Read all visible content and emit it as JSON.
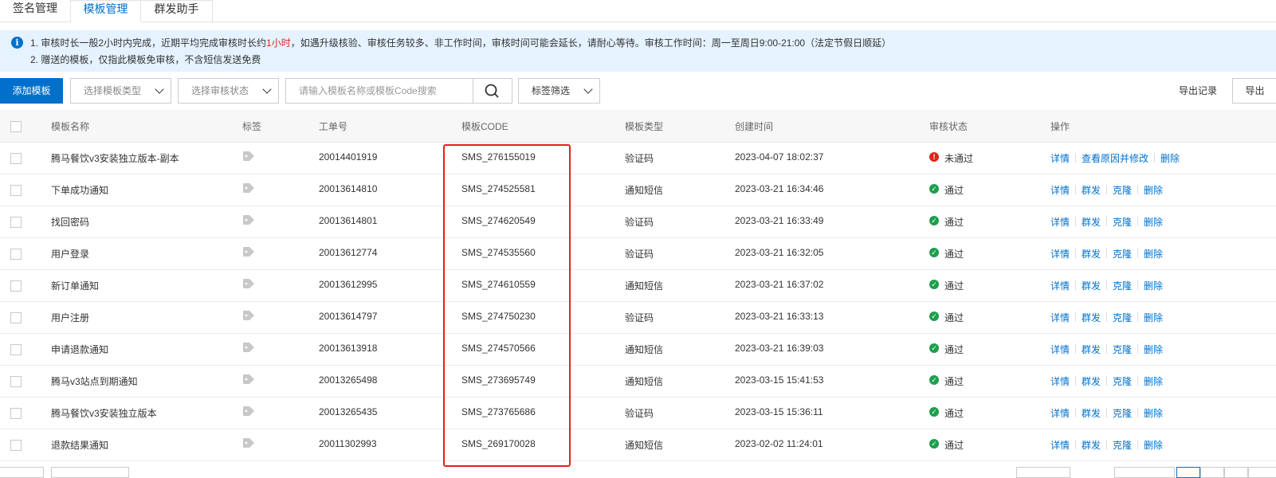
{
  "tabs": [
    {
      "label": "签名管理"
    },
    {
      "label": "模板管理"
    },
    {
      "label": "群发助手"
    }
  ],
  "notice": {
    "line1_pre": "1. 审核时长一般2小时内完成，近期平均完成审核时长约",
    "line1_highlight": "1小时",
    "line1_post": "，如遇升级核验、审核任务较多、非工作时间，审核时间可能会延长，请耐心等待。审核工作时间：周一至周日9:00-21:00（法定节假日顺延）",
    "line2": "2. 赠送的模板，仅指此模板免审核，不含短信发送免费"
  },
  "toolbar": {
    "add_label": "添加模板",
    "type_select": "选择模板类型",
    "status_select": "选择审核状态",
    "search_placeholder": "请输入模板名称或模板Code搜索",
    "tag_filter": "标签筛选",
    "export_record": "导出记录",
    "export": "导出"
  },
  "table": {
    "headers": {
      "name": "模板名称",
      "tag": "标签",
      "ticket": "工单号",
      "code": "模板CODE",
      "type": "模板类型",
      "created": "创建时间",
      "status": "审核状态",
      "ops": "操作"
    },
    "rows": [
      {
        "name": "腾马餐饮v3安装独立版本-副本",
        "ticket": "20014401919",
        "code": "SMS_276155019",
        "type": "验证码",
        "created": "2023-04-07 18:02:37",
        "status": "未通过",
        "ok": false,
        "ops": [
          "详情",
          "查看原因并修改",
          "删除"
        ]
      },
      {
        "name": "下单成功通知",
        "ticket": "20013614810",
        "code": "SMS_274525581",
        "type": "通知短信",
        "created": "2023-03-21 16:34:46",
        "status": "通过",
        "ok": true,
        "ops": [
          "详情",
          "群发",
          "克隆",
          "删除"
        ]
      },
      {
        "name": "找回密码",
        "ticket": "20013614801",
        "code": "SMS_274620549",
        "type": "验证码",
        "created": "2023-03-21 16:33:49",
        "status": "通过",
        "ok": true,
        "ops": [
          "详情",
          "群发",
          "克隆",
          "删除"
        ]
      },
      {
        "name": "用户登录",
        "ticket": "20013612774",
        "code": "SMS_274535560",
        "type": "验证码",
        "created": "2023-03-21 16:32:05",
        "status": "通过",
        "ok": true,
        "ops": [
          "详情",
          "群发",
          "克隆",
          "删除"
        ]
      },
      {
        "name": "新订单通知",
        "ticket": "20013612995",
        "code": "SMS_274610559",
        "type": "通知短信",
        "created": "2023-03-21 16:37:02",
        "status": "通过",
        "ok": true,
        "ops": [
          "详情",
          "群发",
          "克隆",
          "删除"
        ]
      },
      {
        "name": "用户注册",
        "ticket": "20013614797",
        "code": "SMS_274750230",
        "type": "验证码",
        "created": "2023-03-21 16:33:13",
        "status": "通过",
        "ok": true,
        "ops": [
          "详情",
          "群发",
          "克隆",
          "删除"
        ]
      },
      {
        "name": "申请退款通知",
        "ticket": "20013613918",
        "code": "SMS_274570566",
        "type": "通知短信",
        "created": "2023-03-21 16:39:03",
        "status": "通过",
        "ok": true,
        "ops": [
          "详情",
          "群发",
          "克隆",
          "删除"
        ]
      },
      {
        "name": "腾马v3站点到期通知",
        "ticket": "20013265498",
        "code": "SMS_273695749",
        "type": "通知短信",
        "created": "2023-03-15 15:41:53",
        "status": "通过",
        "ok": true,
        "ops": [
          "详情",
          "群发",
          "克隆",
          "删除"
        ]
      },
      {
        "name": "腾马餐饮v3安装独立版本",
        "ticket": "20013265435",
        "code": "SMS_273765686",
        "type": "验证码",
        "created": "2023-03-15 15:36:11",
        "status": "通过",
        "ok": true,
        "ops": [
          "详情",
          "群发",
          "克隆",
          "删除"
        ]
      },
      {
        "name": "退款结果通知",
        "ticket": "20011302993",
        "code": "SMS_269170028",
        "type": "通知短信",
        "created": "2023-02-02 11:24:01",
        "status": "通过",
        "ok": true,
        "ops": [
          "详情",
          "群发",
          "克隆",
          "删除"
        ]
      }
    ]
  },
  "colors": {
    "accent": "#0070cc",
    "highlight_box": "#e0241b",
    "ok": "#1e9f4b",
    "fail": "#e0241b"
  }
}
